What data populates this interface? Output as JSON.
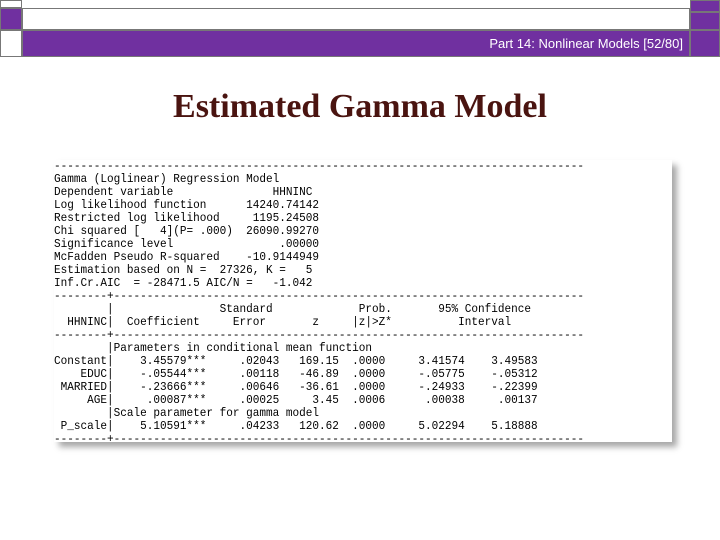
{
  "header": {
    "slide_label": "Part 14: Nonlinear Models [52/80]"
  },
  "slide": {
    "title": "Estimated Gamma Model"
  },
  "output": {
    "lines": [
      "--------------------------------------------------------------------------------",
      "Gamma (Loglinear) Regression Model",
      "Dependent variable               HHNINC",
      "Log likelihood function      14240.74142",
      "Restricted log likelihood     1195.24508",
      "Chi squared [   4](P= .000)  26090.99270",
      "Significance level                .00000",
      "McFadden Pseudo R-squared    -10.9144949",
      "Estimation based on N =  27326, K =   5",
      "Inf.Cr.AIC  = -28471.5 AIC/N =   -1.042",
      "--------+-----------------------------------------------------------------------",
      "        |                Standard             Prob.       95% Confidence",
      "  HHNINC|  Coefficient     Error       z     |z|>Z*          Interval",
      "--------+-----------------------------------------------------------------------",
      "        |Parameters in conditional mean function",
      "Constant|    3.45579***     .02043   169.15  .0000     3.41574    3.49583",
      "    EDUC|    -.05544***     .00118   -46.89  .0000     -.05775    -.05312",
      " MARRIED|    -.23666***     .00646   -36.61  .0000     -.24933    -.22399",
      "     AGE|     .00087***     .00025     3.45  .0006      .00038     .00137",
      "        |Scale parameter for gamma model",
      " P_scale|    5.10591***     .04233   120.62  .0000     5.02294    5.18888",
      "--------+-----------------------------------------------------------------------"
    ]
  }
}
